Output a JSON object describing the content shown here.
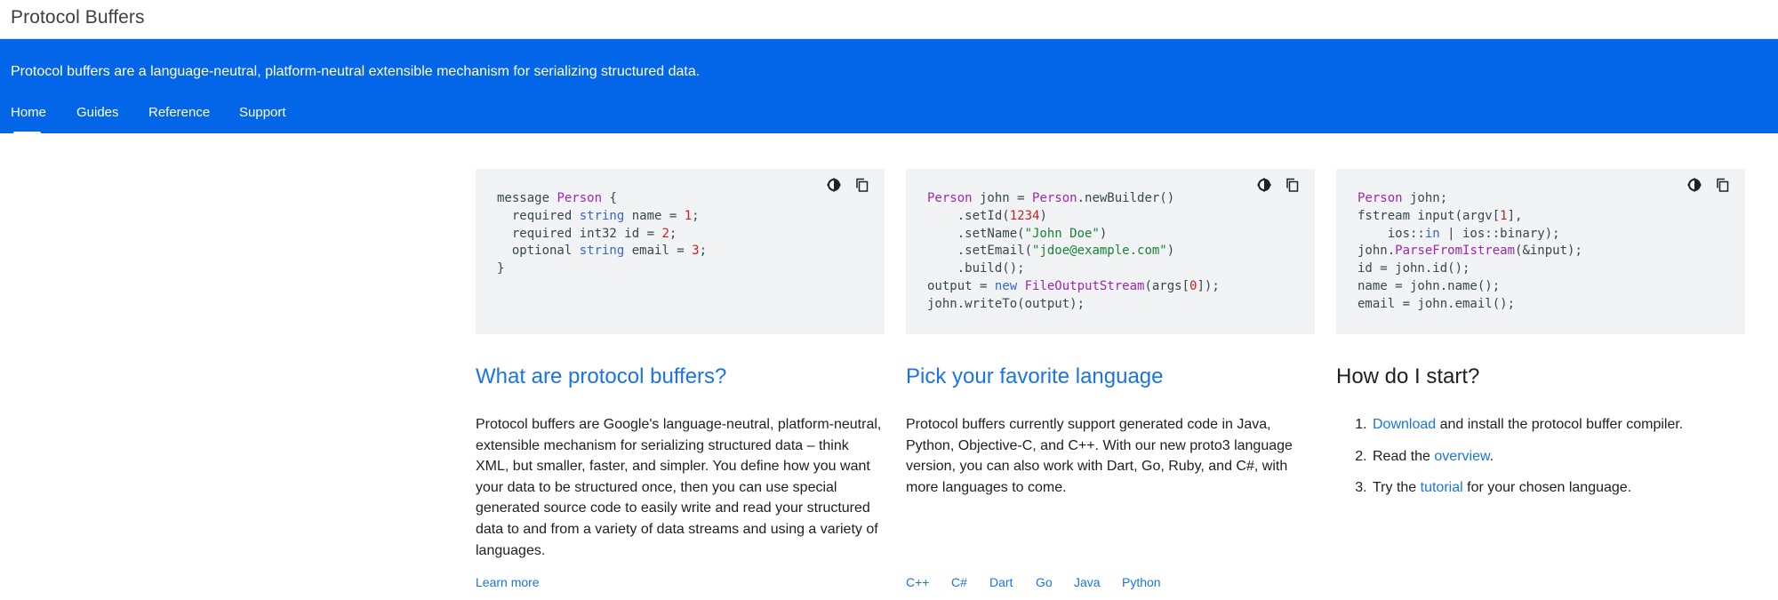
{
  "header": {
    "site_title": "Protocol Buffers"
  },
  "banner": {
    "tagline": "Protocol buffers are a language-neutral, platform-neutral extensible mechanism for serializing structured data.",
    "tabs": [
      {
        "label": "Home",
        "active": true
      },
      {
        "label": "Guides",
        "active": false
      },
      {
        "label": "Reference",
        "active": false
      },
      {
        "label": "Support",
        "active": false
      }
    ]
  },
  "code_samples": {
    "theme_icon": "dark-mode-icon",
    "copy_icon": "copy-icon",
    "proto": [
      "message Person {",
      "  required string name = 1;",
      "  required int32 id = 2;",
      "  optional string email = 3;",
      "}"
    ],
    "java": [
      "Person john = Person.newBuilder()",
      "    .setId(1234)",
      "    .setName(\"John Doe\")",
      "    .setEmail(\"jdoe@example.com\")",
      "    .build();",
      "output = new FileOutputStream(args[0]);",
      "john.writeTo(output);"
    ],
    "cpp": [
      "Person john;",
      "fstream input(argv[1],",
      "    ios::in | ios::binary);",
      "john.ParseFromIstream(&input);",
      "id = john.id();",
      "name = john.name();",
      "email = john.email();"
    ]
  },
  "sections": {
    "what": {
      "title": "What are protocol buffers?",
      "body": "Protocol buffers are Google's language-neutral, platform-neutral, extensible mechanism for serializing structured data – think XML, but smaller, faster, and simpler. You define how you want your data to be structured once, then you can use special generated source code to easily write and read your structured data to and from a variety of data streams and using a variety of languages.",
      "link": "Learn more"
    },
    "language": {
      "title": "Pick your favorite language",
      "body": "Protocol buffers currently support generated code in Java, Python, Objective-C, and C++. With our new proto3 language version, you can also work with Dart, Go, Ruby, and C#, with more languages to come.",
      "links": [
        "C++",
        "C#",
        "Dart",
        "Go",
        "Java",
        "Python"
      ]
    },
    "start": {
      "title": "How do I start?",
      "steps": [
        {
          "link": "Download",
          "after": " and install the protocol buffer compiler.",
          "before": ""
        },
        {
          "before": "Read the ",
          "link": "overview",
          "after": "."
        },
        {
          "before": "Try the ",
          "link": "tutorial",
          "after": " for your chosen language."
        }
      ]
    }
  },
  "colors": {
    "banner": "#0366e8",
    "link": "#1a73e8",
    "code_bg": "#f1f3f4"
  }
}
